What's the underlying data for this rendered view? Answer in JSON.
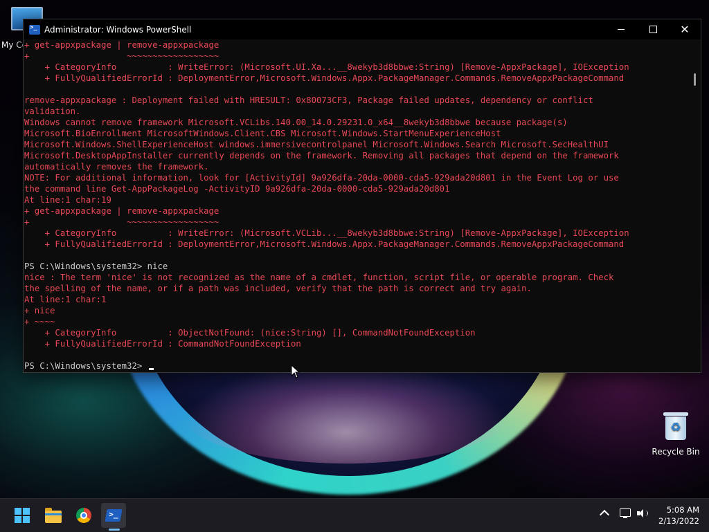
{
  "desktop": {
    "icons": {
      "my_computer": "My Co",
      "recycle_bin": "Recycle Bin"
    }
  },
  "window": {
    "title": "Administrator: Windows PowerShell",
    "icon": "powershell-icon",
    "controls": {
      "minimize": "minimize-icon",
      "maximize": "maximize-icon",
      "close": "close-icon"
    },
    "error_color": "#e74856",
    "text_color": "#cccccc",
    "background": "#0c0c0c"
  },
  "console": {
    "lines": [
      {
        "type": "err",
        "text": "+ get-appxpackage | remove-appxpackage"
      },
      {
        "type": "err",
        "text": "+                   ~~~~~~~~~~~~~~~~~~"
      },
      {
        "type": "err",
        "text": "    + CategoryInfo          : WriteError: (Microsoft.UI.Xa...__8wekyb3d8bbwe:String) [Remove-AppxPackage], IOException"
      },
      {
        "type": "err",
        "text": "    + FullyQualifiedErrorId : DeploymentError,Microsoft.Windows.Appx.PackageManager.Commands.RemoveAppxPackageCommand"
      },
      {
        "type": "err",
        "text": ""
      },
      {
        "type": "err",
        "text": "remove-appxpackage : Deployment failed with HRESULT: 0x80073CF3, Package failed updates, dependency or conflict"
      },
      {
        "type": "err",
        "text": "validation."
      },
      {
        "type": "err",
        "text": "Windows cannot remove framework Microsoft.VCLibs.140.00_14.0.29231.0_x64__8wekyb3d8bbwe because package(s)"
      },
      {
        "type": "err",
        "text": "Microsoft.BioEnrollment MicrosoftWindows.Client.CBS Microsoft.Windows.StartMenuExperienceHost"
      },
      {
        "type": "err",
        "text": "Microsoft.Windows.ShellExperienceHost windows.immersivecontrolpanel Microsoft.Windows.Search Microsoft.SecHealthUI"
      },
      {
        "type": "err",
        "text": "Microsoft.DesktopAppInstaller currently depends on the framework. Removing all packages that depend on the framework"
      },
      {
        "type": "err",
        "text": "automatically removes the framework."
      },
      {
        "type": "err",
        "text": "NOTE: For additional information, look for [ActivityId] 9a926dfa-20da-0000-cda5-929ada20d801 in the Event Log or use"
      },
      {
        "type": "err",
        "text": "the command line Get-AppPackageLog -ActivityID 9a926dfa-20da-0000-cda5-929ada20d801"
      },
      {
        "type": "err",
        "text": "At line:1 char:19"
      },
      {
        "type": "err",
        "text": "+ get-appxpackage | remove-appxpackage"
      },
      {
        "type": "err",
        "text": "+                   ~~~~~~~~~~~~~~~~~~"
      },
      {
        "type": "err",
        "text": "    + CategoryInfo          : WriteError: (Microsoft.VCLib...__8wekyb3d8bbwe:String) [Remove-AppxPackage], IOException"
      },
      {
        "type": "err",
        "text": "    + FullyQualifiedErrorId : DeploymentError,Microsoft.Windows.Appx.PackageManager.Commands.RemoveAppxPackageCommand"
      },
      {
        "type": "prompt",
        "text": ""
      },
      {
        "type": "prompt",
        "text": "PS C:\\Windows\\system32> nice"
      },
      {
        "type": "err",
        "text": "nice : The term 'nice' is not recognized as the name of a cmdlet, function, script file, or operable program. Check"
      },
      {
        "type": "err",
        "text": "the spelling of the name, or if a path was included, verify that the path is correct and try again."
      },
      {
        "type": "err",
        "text": "At line:1 char:1"
      },
      {
        "type": "err",
        "text": "+ nice"
      },
      {
        "type": "err",
        "text": "+ ~~~~"
      },
      {
        "type": "err",
        "text": "    + CategoryInfo          : ObjectNotFound: (nice:String) [], CommandNotFoundException"
      },
      {
        "type": "err",
        "text": "    + FullyQualifiedErrorId : CommandNotFoundException"
      },
      {
        "type": "prompt",
        "text": ""
      }
    ],
    "current_prompt": "PS C:\\Windows\\system32> "
  },
  "taskbar": {
    "apps": [
      {
        "name": "start",
        "icon": "windows-logo-icon"
      },
      {
        "name": "file-explorer",
        "icon": "folder-icon"
      },
      {
        "name": "chrome",
        "icon": "chrome-icon"
      },
      {
        "name": "powershell",
        "icon": "powershell-icon",
        "active": true
      }
    ],
    "tray": {
      "chevron": "chevron-up-icon",
      "network": "network-icon",
      "volume": "volume-icon"
    },
    "clock": {
      "time": "5:08 AM",
      "date": "2/13/2022"
    }
  }
}
